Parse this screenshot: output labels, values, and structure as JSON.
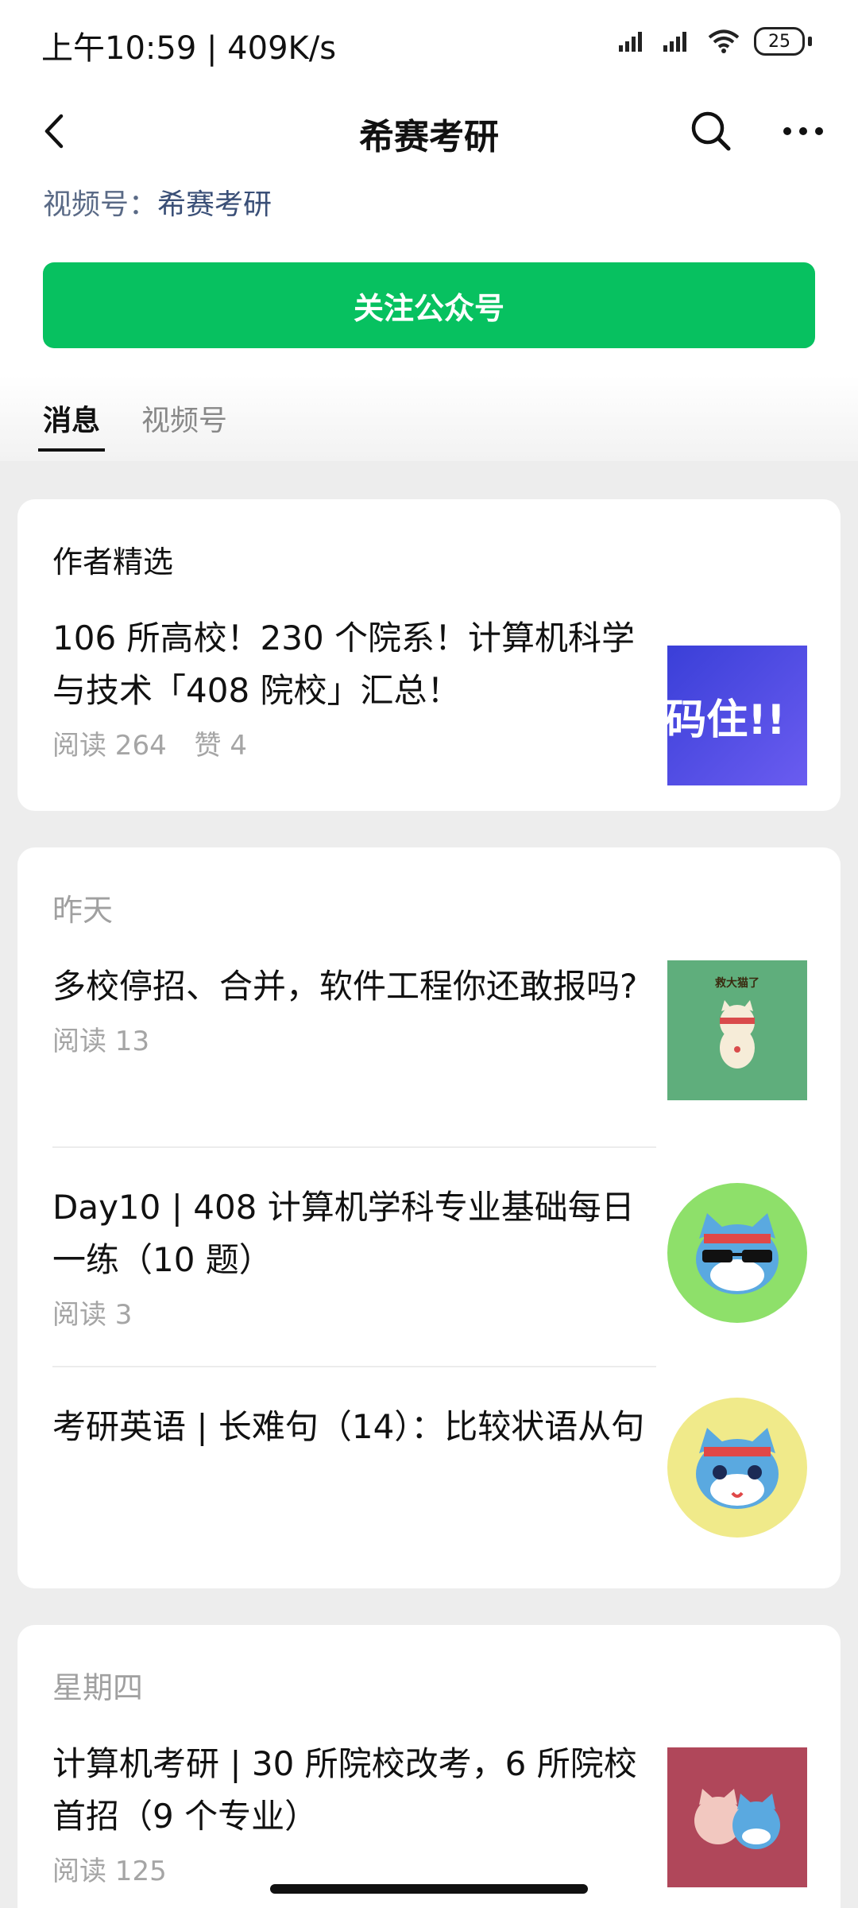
{
  "status": {
    "time": "上午10:59 | 409K/s",
    "battery": "25"
  },
  "header": {
    "title": "希赛考研"
  },
  "profile": {
    "channels_label": "视频号：",
    "channels_value": "希赛考研",
    "follow_button": "关注公众号"
  },
  "tabs": [
    "消息",
    "视频号"
  ],
  "sections": [
    {
      "heading": "作者精选",
      "items": [
        {
          "title": "106 所高校！230 个院系！计算机科学与技术「408 院校」汇总！",
          "read": "阅读 264",
          "like": "赞 4",
          "thumb_text": "码住!!"
        }
      ]
    },
    {
      "heading": "昨天",
      "items": [
        {
          "title": "多校停招、合并，软件工程你还敢报吗?",
          "read": "阅读 13",
          "thumb_caption": "救大猫了"
        },
        {
          "title": "Day10 | 408 计算机学科专业基础每日一练（10 题）",
          "read": "阅读 3"
        },
        {
          "title": "考研英语 | 长难句（14）：比较状语从句"
        }
      ]
    },
    {
      "heading": "星期四",
      "items": [
        {
          "title": "计算机考研 | 30 所院校改考，6 所院校首招（9 个专业）",
          "read": "阅读 125"
        }
      ]
    }
  ],
  "colors": {
    "accent_green": "#07c160",
    "link_blue": "#3a4f77"
  }
}
